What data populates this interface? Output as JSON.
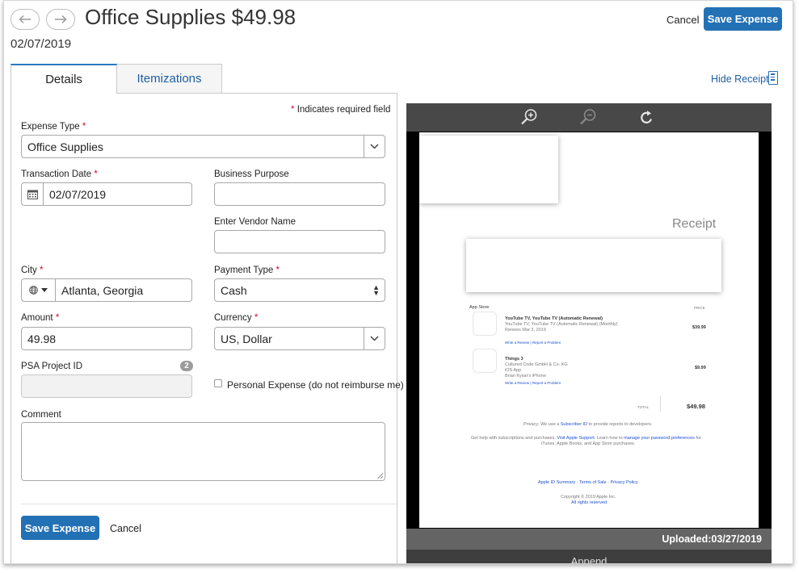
{
  "header": {
    "title": "Office Supplies $49.98",
    "date": "02/07/2019",
    "cancel_label": "Cancel",
    "save_label": "Save Expense",
    "back_icon": "arrow-left-icon",
    "forward_icon": "arrow-right-icon"
  },
  "tabs": [
    {
      "label": "Details",
      "active": true
    },
    {
      "label": "Itemizations",
      "active": false
    }
  ],
  "hide_receipt_label": "Hide Receipt",
  "form": {
    "required_note": "Indicates required field",
    "required_mark": "*",
    "expense_type": {
      "label": "Expense Type",
      "value": "Office Supplies"
    },
    "transaction_date": {
      "label": "Transaction Date",
      "value": "02/07/2019"
    },
    "business_purpose": {
      "label": "Business Purpose",
      "value": ""
    },
    "vendor_name": {
      "label": "Enter Vendor Name",
      "value": ""
    },
    "city": {
      "label": "City",
      "value": "Atlanta, Georgia"
    },
    "payment_type": {
      "label": "Payment Type",
      "value": "Cash"
    },
    "amount": {
      "label": "Amount",
      "value": "49.98"
    },
    "currency": {
      "label": "Currency",
      "value": "US, Dollar"
    },
    "psa_project": {
      "label": "PSA Project ID",
      "badge": "2",
      "value": ""
    },
    "personal_expense": {
      "label": "Personal Expense (do not reimburse me)",
      "checked": false
    },
    "comment": {
      "label": "Comment",
      "value": ""
    },
    "save_label": "Save Expense",
    "cancel_label": "Cancel"
  },
  "viewer": {
    "tools": [
      "zoom-in-icon",
      "zoom-out-icon",
      "rotate-icon"
    ],
    "uploaded": "Uploaded:03/27/2019",
    "append_label": "Append",
    "receipt": {
      "title": "Receipt",
      "store": "App Store",
      "price_header": "PRICE",
      "items": [
        {
          "name": "YouTube TV, YouTube TV (Automatic Renewal)",
          "line2": "YouTube TV, YouTube TV (Automatic Renewal) (Monthly)",
          "line3": "Renews Mar 3, 2019",
          "line4": "",
          "links": "Write a Review | Report a Problem",
          "price": "$39.99"
        },
        {
          "name": "Things 3",
          "line2": "Cultured Code GmbH & Co. KG",
          "line3": "iOS App",
          "line4": "Brian Kysar's iPhone",
          "links": "Write a Review | Report a Problem",
          "price": "$9.99"
        }
      ],
      "total_label": "TOTAL",
      "total": "$49.98",
      "privacy_pre": "Privacy: We use a",
      "privacy_link": "Subscriber ID",
      "privacy_post": "to provide reports to developers.",
      "help_pre": "Get help with subscriptions and purchases.",
      "help_link1": "Visit Apple Support",
      "help_mid": ". Learn how to",
      "help_link2": "manage your password preferences",
      "help_post": "for",
      "help_line2": "iTunes, Apple Books, and App Store purchases.",
      "footer_links": "Apple ID Summary · Terms of Sale · Privacy Policy",
      "copyright": "Copyright © 2019 Apple Inc.",
      "rights": "All rights reserved"
    }
  }
}
